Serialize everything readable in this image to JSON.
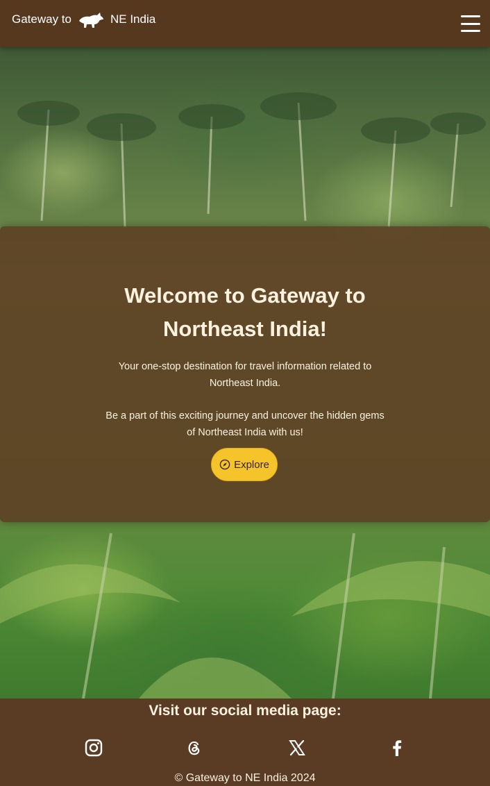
{
  "navbar": {
    "brand_prefix": "Gateway to",
    "brand_suffix": "NE India",
    "logo_icon": "rhino-silhouette-icon",
    "menu_icon": "hamburger-menu-icon"
  },
  "hero": {
    "background": "palm-forest-video"
  },
  "welcome": {
    "title": "Welcome to Gateway to Northeast India!",
    "subtitle": "Your one-stop destination for travel information related to Northeast India.",
    "subtitle2": "Be a part of this exciting journey and uncover the hidden gems of Northeast India with us!",
    "explore_label": "Explore",
    "explore_icon": "compass-icon"
  },
  "footer": {
    "social_heading": "Visit our social media page:",
    "social_links": [
      {
        "icon": "instagram-icon"
      },
      {
        "icon": "threads-icon"
      },
      {
        "icon": "x-twitter-icon"
      },
      {
        "icon": "facebook-icon"
      }
    ],
    "copyright": "© Gateway to NE India 2024"
  },
  "colors": {
    "brand_brown": "#5a3c24",
    "accent_yellow": "#f4c42a",
    "text_light": "#fdf1e0"
  }
}
